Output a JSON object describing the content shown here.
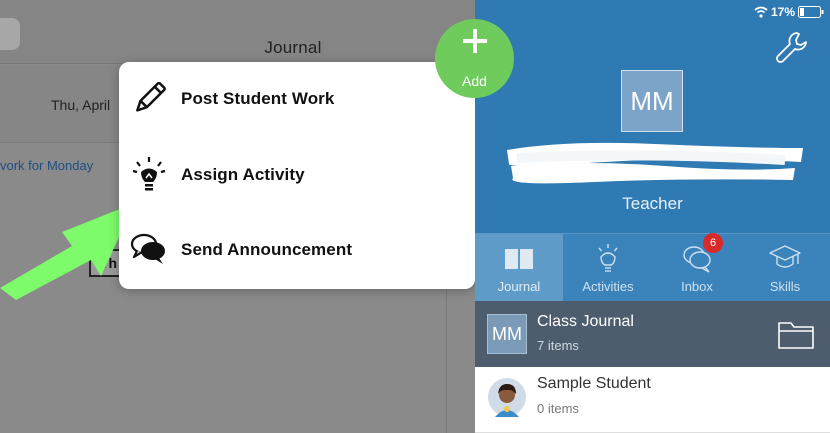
{
  "status_bar": {
    "battery": "17%"
  },
  "journal": {
    "title": "Journal",
    "date": "Thu, April",
    "assignment_snippet": "vork for Monday",
    "badge": "Th"
  },
  "add_button": {
    "label": "Add"
  },
  "popup_menu": {
    "items": [
      {
        "label": "Post Student Work",
        "icon": "pencil-icon"
      },
      {
        "label": "Assign Activity",
        "icon": "lightbulb-icon"
      },
      {
        "label": "Send Announcement",
        "icon": "chat-bubbles-icon"
      }
    ]
  },
  "profile": {
    "initials": "MM",
    "role": "Teacher"
  },
  "tabs": [
    {
      "label": "Journal",
      "icon": "book-icon",
      "active": true
    },
    {
      "label": "Activities",
      "icon": "lightbulb-icon"
    },
    {
      "label": "Inbox",
      "icon": "chat-bubbles-icon",
      "badge": "6"
    },
    {
      "label": "Skills",
      "icon": "graduation-cap-icon"
    }
  ],
  "class_journal": {
    "initials": "MM",
    "title": "Class Journal",
    "count": "7 items"
  },
  "student": {
    "name": "Sample Student",
    "count": "0 items"
  },
  "colors": {
    "profile_blue": "#2f7ab3",
    "add_green": "#6ecb5c",
    "arrow_green": "#7dfb6a",
    "badge_red": "#d92a2a"
  }
}
